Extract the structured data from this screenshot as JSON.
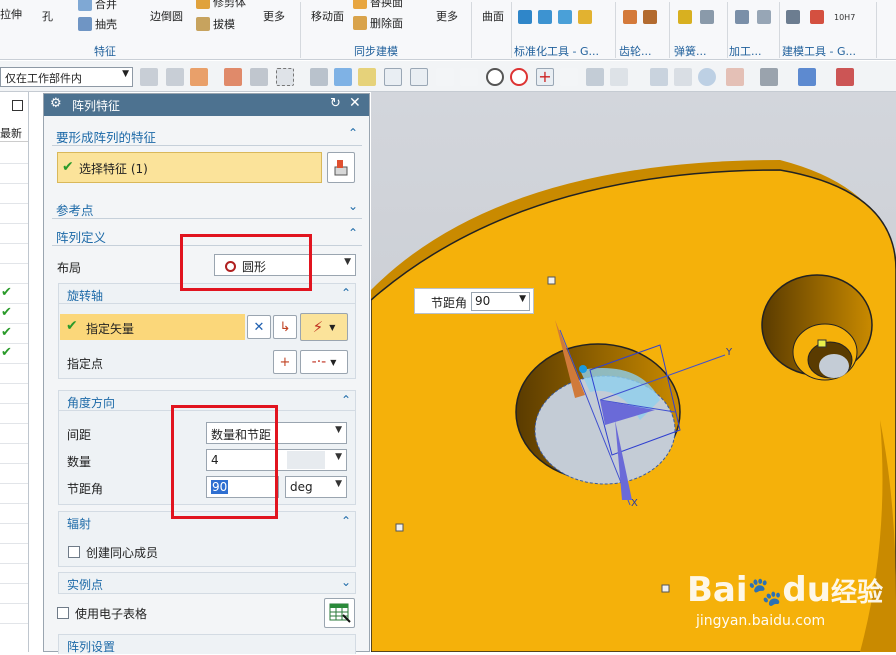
{
  "ribbon": {
    "items": [
      "拉伸",
      "孔",
      "合并",
      "抽壳",
      "边倒圆",
      "修剪体",
      "拔模",
      "更多",
      "移动面",
      "替换面",
      "删除面",
      "更多",
      "曲面"
    ],
    "groups": [
      "特征",
      "同步建模",
      "标准化工具 - G...",
      "齿轮...",
      "弹簧...",
      "加工...",
      "建模工具 - G..."
    ],
    "icon_label_10h7": "10H7"
  },
  "toolbar": {
    "scope_value": "仅在工作部件内"
  },
  "nav": {
    "header": "最新"
  },
  "dialog": {
    "title": "阵列特征",
    "header_icons": [
      "reset-icon",
      "close-icon"
    ],
    "sections": {
      "features": {
        "title": "要形成阵列的特征",
        "select_label": "选择特征 (1)"
      },
      "reference": {
        "title": "参考点"
      },
      "definition": {
        "title": "阵列定义",
        "layout_label": "布局",
        "layout_value": "圆形",
        "rotation_axis": {
          "title": "旋转轴",
          "vector_label": "指定矢量",
          "point_label": "指定点"
        },
        "angle_direction": {
          "title": "角度方向",
          "spacing_label": "间距",
          "spacing_value": "数量和节距",
          "count_label": "数量",
          "count_value": "4",
          "pitch_label": "节距角",
          "pitch_value": "90",
          "pitch_unit": "deg"
        },
        "radial": {
          "title": "辐射",
          "concentric_label": "创建同心成员"
        },
        "instance_points": {
          "title": "实例点"
        },
        "spreadsheet_label": "使用电子表格"
      },
      "settings": {
        "title": "阵列设置"
      }
    }
  },
  "viewport": {
    "tooltip_label": "节距角",
    "tooltip_value": "90",
    "axis_y": "Y",
    "axis_x": "X",
    "watermark_brand": "Bai",
    "watermark_du": "du",
    "watermark_jingyan": "经验",
    "watermark_url": "jingyan.baidu.com"
  },
  "colors": {
    "part": "#f5b10a",
    "part_shadow": "#c98a00",
    "dialog_header": "#4d7290",
    "highlight": "#fbe39a",
    "annotation": "#e1141f"
  }
}
